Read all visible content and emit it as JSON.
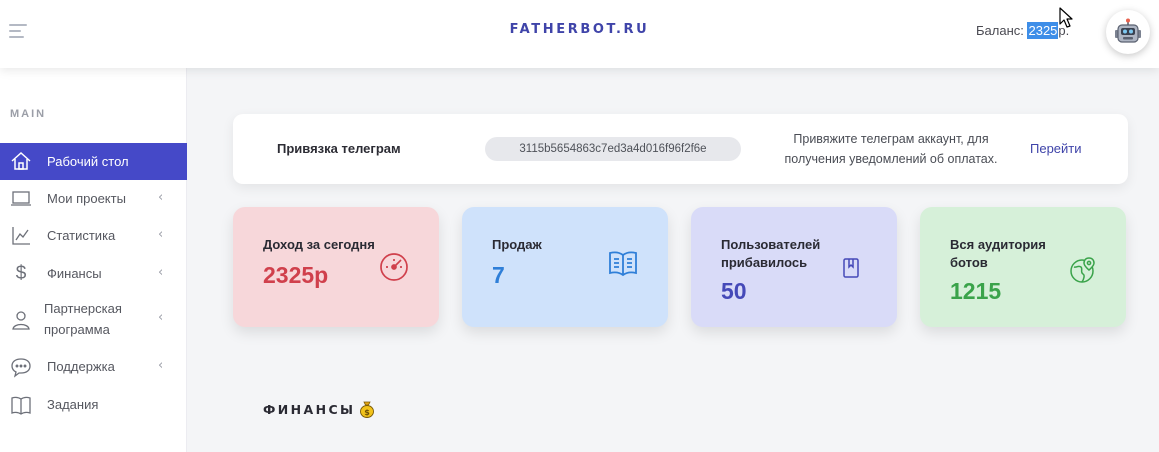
{
  "header": {
    "brand": "FATHERBOT.RU",
    "balance_label": "Баланс: ",
    "balance_value": "2325",
    "balance_suffix": "р."
  },
  "sidebar": {
    "section": "MAIN",
    "items": [
      {
        "label": "Рабочий стол",
        "icon": "home-icon",
        "active": true,
        "chevron": false
      },
      {
        "label": "Мои проекты",
        "icon": "laptop-icon",
        "chevron": true
      },
      {
        "label": "Статистика",
        "icon": "chart-icon",
        "chevron": true
      },
      {
        "label": "Финансы",
        "icon": "dollar-icon",
        "chevron": true
      },
      {
        "label": "Партнерская программа",
        "label_line1": "Партнерская",
        "label_line2": "программа",
        "icon": "user-icon",
        "chevron": true
      },
      {
        "label": "Поддержка",
        "icon": "chat-icon",
        "chevron": true
      },
      {
        "label": "Задания",
        "icon": "book-icon",
        "chevron": false
      }
    ],
    "chevron_glyph": "‹"
  },
  "telegram": {
    "title": "Привязка телеграм",
    "token": "3115b5654863c7ed3a4d016f96f2f6e",
    "hint_line1": "Привяжите телеграм аккаунт, для",
    "hint_line2": "получения уведомлений об оплатах.",
    "link": "Перейти"
  },
  "cards": [
    {
      "label": "Доход за сегодня",
      "value": "2325р",
      "bg": "#f7d7da",
      "color": "#d0404c",
      "icon": "speedometer-icon"
    },
    {
      "label": "Продаж",
      "value": "7",
      "bg": "#cfe2fb",
      "color": "#2f7fd8",
      "icon": "open-book-icon"
    },
    {
      "label_line1": "Пользователей",
      "label_line2": "прибавилось",
      "value": "50",
      "bg": "#d9dbf8",
      "color": "#4549b8",
      "icon": "bookmark-icon"
    },
    {
      "label_line1": "Вся аудитория",
      "label_line2": "ботов",
      "value": "1215",
      "bg": "#d6f0d9",
      "color": "#3aa34a",
      "icon": "globe-pin-icon"
    }
  ],
  "finance": {
    "title": "ФИНАНСЫ",
    "icon": "money-bag-icon"
  },
  "colors": {
    "accent": "#4549c8",
    "brand": "#3f44a9",
    "highlight": "#3e8ee8"
  }
}
